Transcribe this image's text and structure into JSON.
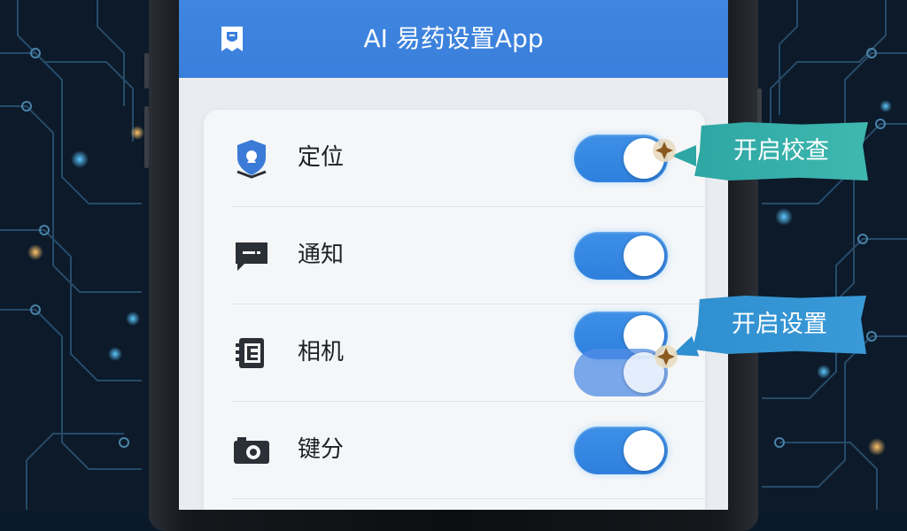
{
  "app": {
    "title": "AI 易药设置App"
  },
  "settings": [
    {
      "label": "定位",
      "icon": "location-shield-icon",
      "enabled": true
    },
    {
      "label": "通知",
      "icon": "message-icon",
      "enabled": true
    },
    {
      "label": "相机",
      "icon": "camera-icon",
      "enabled": true
    },
    {
      "label": "键分",
      "icon": "camera-alt-icon",
      "enabled": true
    }
  ],
  "annotations": {
    "first": "开启校查",
    "second": "开启设置"
  },
  "colors": {
    "header": "#3a7fdb",
    "toggle_on": "#2f80de",
    "callout_teal": "#2ea7a4",
    "callout_blue": "#2f8fcf"
  }
}
